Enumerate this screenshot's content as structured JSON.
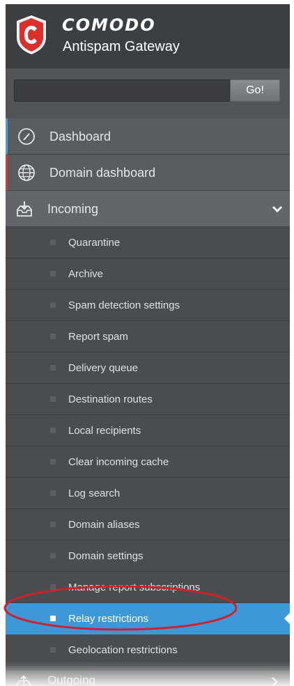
{
  "brand": {
    "name": "COMODO",
    "subtitle": "Antispam Gateway"
  },
  "search": {
    "value": "",
    "button_label": "Go!"
  },
  "nav": {
    "dashboard": {
      "label": "Dashboard",
      "icon": "gauge-icon"
    },
    "domain_dashboard": {
      "label": "Domain dashboard",
      "icon": "globe-icon"
    },
    "incoming": {
      "label": "Incoming",
      "icon": "inbox-download-icon",
      "expanded": true
    }
  },
  "incoming_items": [
    {
      "label": "Quarantine"
    },
    {
      "label": "Archive"
    },
    {
      "label": "Spam detection settings"
    },
    {
      "label": "Report spam"
    },
    {
      "label": "Delivery queue"
    },
    {
      "label": "Destination routes"
    },
    {
      "label": "Local recipients"
    },
    {
      "label": "Clear incoming cache"
    },
    {
      "label": "Log search"
    },
    {
      "label": "Domain aliases"
    },
    {
      "label": "Domain settings"
    },
    {
      "label": "Manage report subscriptions"
    },
    {
      "label": "Relay restrictions",
      "active": true
    },
    {
      "label": "Geolocation restrictions"
    }
  ],
  "outgoing": {
    "label": "Outgoing",
    "icon": "outbox-upload-icon"
  },
  "colors": {
    "sidebar_bg": "#474a4d",
    "active_bg": "#3e97d7",
    "highlight_ellipse": "#d0202a"
  }
}
